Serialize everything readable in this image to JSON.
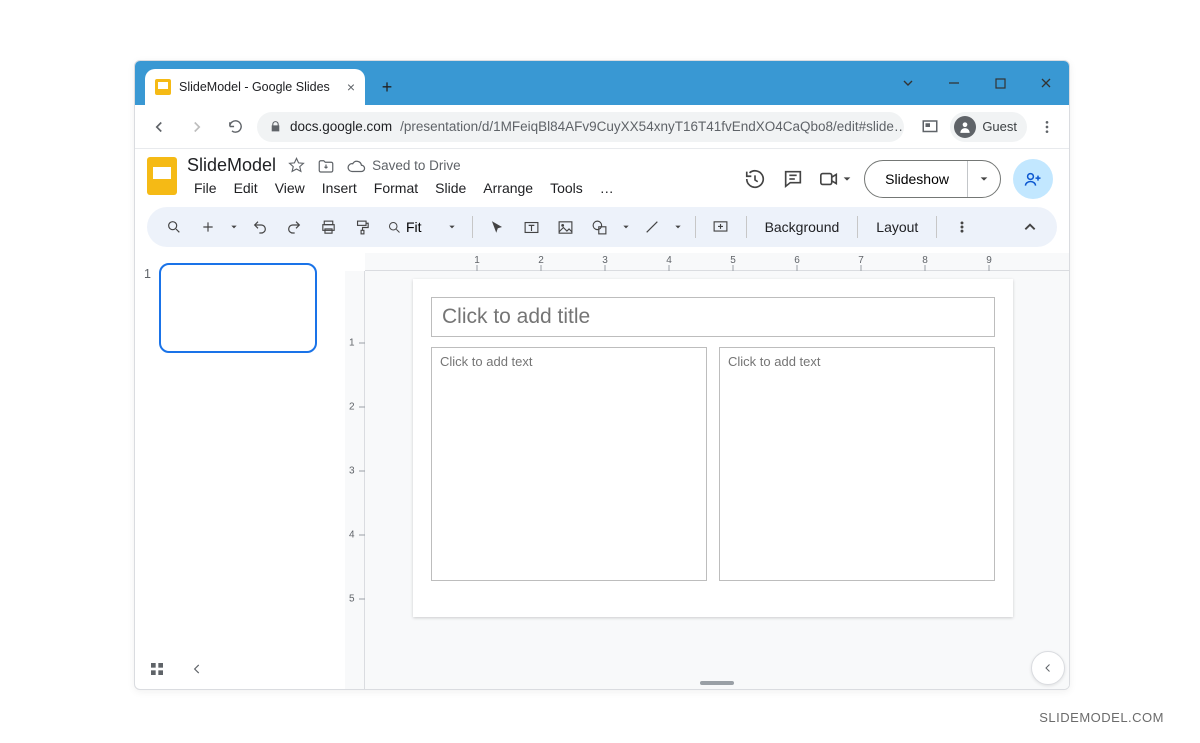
{
  "browser": {
    "tab_title": "SlideModel - Google Slides",
    "url_domain": "docs.google.com",
    "url_path": "/presentation/d/1MFeiqBl84AFv9CuyXX54xnyT16T41fvEndXO4CaQbo8/edit#slide…",
    "guest_label": "Guest"
  },
  "docbar": {
    "title": "SlideModel",
    "save_status": "Saved to Drive"
  },
  "menubar": {
    "items": [
      "File",
      "Edit",
      "View",
      "Insert",
      "Format",
      "Slide",
      "Arrange",
      "Tools",
      "…"
    ]
  },
  "header_actions": {
    "slideshow_label": "Slideshow"
  },
  "toolbar": {
    "zoom_label": "Fit",
    "background_label": "Background",
    "layout_label": "Layout"
  },
  "filmstrip": {
    "slides": [
      {
        "number": "1"
      }
    ]
  },
  "ruler": {
    "h": [
      "1",
      "2",
      "3",
      "4",
      "5",
      "6",
      "7",
      "8",
      "9"
    ],
    "v": [
      "1",
      "2",
      "3",
      "4",
      "5"
    ]
  },
  "canvas": {
    "title_placeholder": "Click to add title",
    "text_placeholder_left": "Click to add text",
    "text_placeholder_right": "Click to add text"
  },
  "watermark": "SLIDEMODEL.COM"
}
